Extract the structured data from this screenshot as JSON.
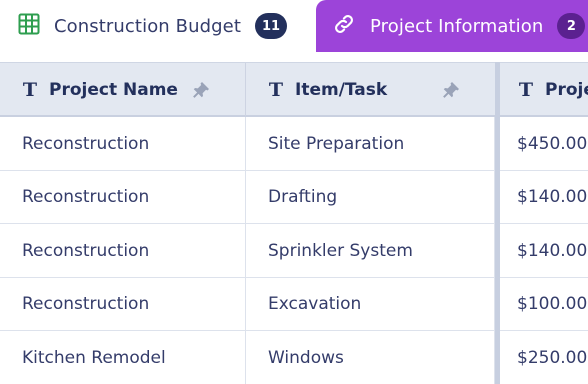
{
  "tabs": [
    {
      "label": "Construction Budget",
      "count": "11",
      "icon": "spreadsheet-icon",
      "active": false
    },
    {
      "label": "Project Information",
      "count": "2",
      "icon": "link-icon",
      "active": true
    }
  ],
  "columns": [
    {
      "label": "Project Name",
      "type_icon": "T",
      "pinned": true
    },
    {
      "label": "Item/Task",
      "type_icon": "T",
      "pinned": true
    },
    {
      "label": "Proje",
      "type_icon": "T",
      "pinned": false
    }
  ],
  "rows": [
    {
      "project_name": "Reconstruction",
      "item_task": "Site Preparation",
      "cost": "$450.00"
    },
    {
      "project_name": "Reconstruction",
      "item_task": "Drafting",
      "cost": "$140.00"
    },
    {
      "project_name": "Reconstruction",
      "item_task": "Sprinkler System",
      "cost": "$140.00"
    },
    {
      "project_name": "Reconstruction",
      "item_task": "Excavation",
      "cost": "$100.00"
    },
    {
      "project_name": "Kitchen Remodel",
      "item_task": "Windows",
      "cost": "$250.00"
    }
  ],
  "colors": {
    "tab_active_bg": "#9c44d9",
    "header_bg": "#e3e8f1",
    "text_dark": "#23305c",
    "spreadsheet_icon": "#2e9e4f"
  }
}
